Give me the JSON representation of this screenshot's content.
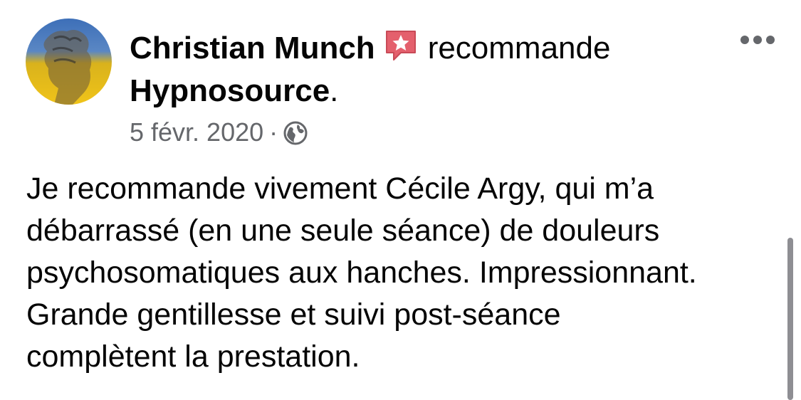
{
  "post": {
    "author": "Christian Munch",
    "action": "recommande",
    "page": "Hypnosource",
    "page_suffix": ".",
    "date": "5 févr. 2020",
    "separator": "·",
    "privacy_icon": "globe-icon",
    "recommendation_icon": "star-speech-bubble-icon",
    "recommendation_icon_color": "#e4606d",
    "more_icon": "more-horizontal-icon",
    "body": "Je recommande vivement Cécile Argy, qui m’a\ndébarrassé (en une seule séance) de douleurs\npsychosomatiques aux hanches. Impressionnant.\nGrande gentillesse et suivi post-séance\ncomplètent la prestation."
  },
  "colors": {
    "text_primary": "#050505",
    "text_secondary": "#65676b",
    "avatar_top": "#3d6fb8",
    "avatar_bottom": "#f0c419"
  }
}
